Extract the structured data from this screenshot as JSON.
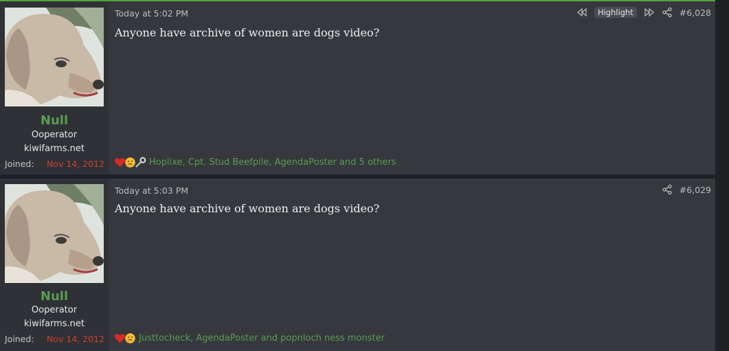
{
  "posts": [
    {
      "username": "Null",
      "user_title": "Ooperator",
      "user_site": "kiwifarms.net",
      "joined_label": "Joined:",
      "joined_date": "Nov 14, 2012",
      "timestamp": "Today at 5:02 PM",
      "highlight_label": "Highlight",
      "post_number": "#6,028",
      "message": "Anyone have archive of women are dogs video?",
      "reactions": [
        "heart-icon",
        "thinking-face-icon",
        "wrench-icon"
      ],
      "reaction_users": "Hoplixe, Cpt. Stud Beefpile, AgendaPoster and 5 others"
    },
    {
      "username": "Null",
      "user_title": "Ooperator",
      "user_site": "kiwifarms.net",
      "joined_label": "Joined:",
      "joined_date": "Nov 14, 2012",
      "timestamp": "Today at 5:03 PM",
      "post_number": "#6,029",
      "message": "Anyone have archive of women are dogs video?",
      "reactions": [
        "heart-icon",
        "thinking-face-icon"
      ],
      "reaction_users": "Justtocheck, AgendaPoster and popnloch ness monster"
    }
  ],
  "colors": {
    "username": "#5b9b52",
    "joined_date": "#c9412f",
    "accent_border": "#56a33b",
    "post_bg": "#36383e",
    "user_col_bg": "#2f3136"
  }
}
